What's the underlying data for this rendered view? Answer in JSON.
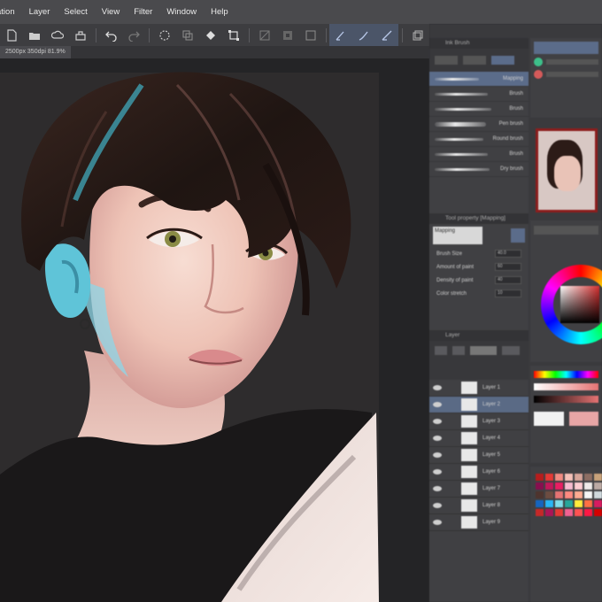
{
  "menubar": {
    "items": [
      "ation",
      "Layer",
      "Select",
      "View",
      "Filter",
      "Window",
      "Help"
    ]
  },
  "canvas_tab": {
    "label": "2500px 350dpi 81.9%"
  },
  "brush_panel": {
    "title": "Ink Brush",
    "brushes": [
      {
        "name": "Mapping",
        "selected": true
      },
      {
        "name": "Brush",
        "selected": false
      },
      {
        "name": "Brush",
        "selected": false
      },
      {
        "name": "Pen brush",
        "selected": false
      },
      {
        "name": "Round brush",
        "selected": false
      },
      {
        "name": "Brush",
        "selected": false
      },
      {
        "name": "Dry brush",
        "selected": false
      }
    ]
  },
  "tool_property": {
    "title": "Tool property [Mapping]",
    "preset": "Mapping",
    "rows": [
      {
        "label": "Brush Size",
        "value": "40.0"
      },
      {
        "label": "Amount of paint",
        "value": "60"
      },
      {
        "label": "Density of paint",
        "value": "40"
      },
      {
        "label": "Color stretch",
        "value": "10"
      }
    ]
  },
  "layer_panel": {
    "title": "Layer",
    "layers": [
      {
        "name": "Layer 1",
        "selected": false
      },
      {
        "name": "Layer 2",
        "selected": true
      },
      {
        "name": "Layer 3",
        "selected": false
      },
      {
        "name": "Layer 4",
        "selected": false
      },
      {
        "name": "Layer 5",
        "selected": false
      },
      {
        "name": "Layer 6",
        "selected": false
      },
      {
        "name": "Layer 7",
        "selected": false
      },
      {
        "name": "Layer 8",
        "selected": false
      },
      {
        "name": "Layer 9",
        "selected": false
      }
    ]
  },
  "colors": {
    "accent": "#5b6c8a",
    "navigator_frame": "#8b1e1e",
    "palette": [
      "#b71c1c",
      "#e53935",
      "#f28b82",
      "#f6c1b8",
      "#d7a69a",
      "#8d6e63",
      "#c8a27a",
      "#ffe0b2",
      "#880e4f",
      "#c2185b",
      "#e91e63",
      "#f8bbd0",
      "#ffcdd2",
      "#efebe9",
      "#bcaaa4",
      "#a1887f",
      "#4e342e",
      "#6d4c41",
      "#e57373",
      "#ff8a80",
      "#ffab91",
      "#f5f5f5",
      "#cfd8dc",
      "#90a4ae",
      "#1565c0",
      "#29b6f6",
      "#80deea",
      "#26a69a",
      "#ffeb3b",
      "#ff7043",
      "#d81b60",
      "#7b1fa2",
      "#c62828",
      "#ad1457",
      "#e53935",
      "#f06292",
      "#ff5252",
      "#ff1744",
      "#d50000",
      "#b71c1c"
    ]
  }
}
